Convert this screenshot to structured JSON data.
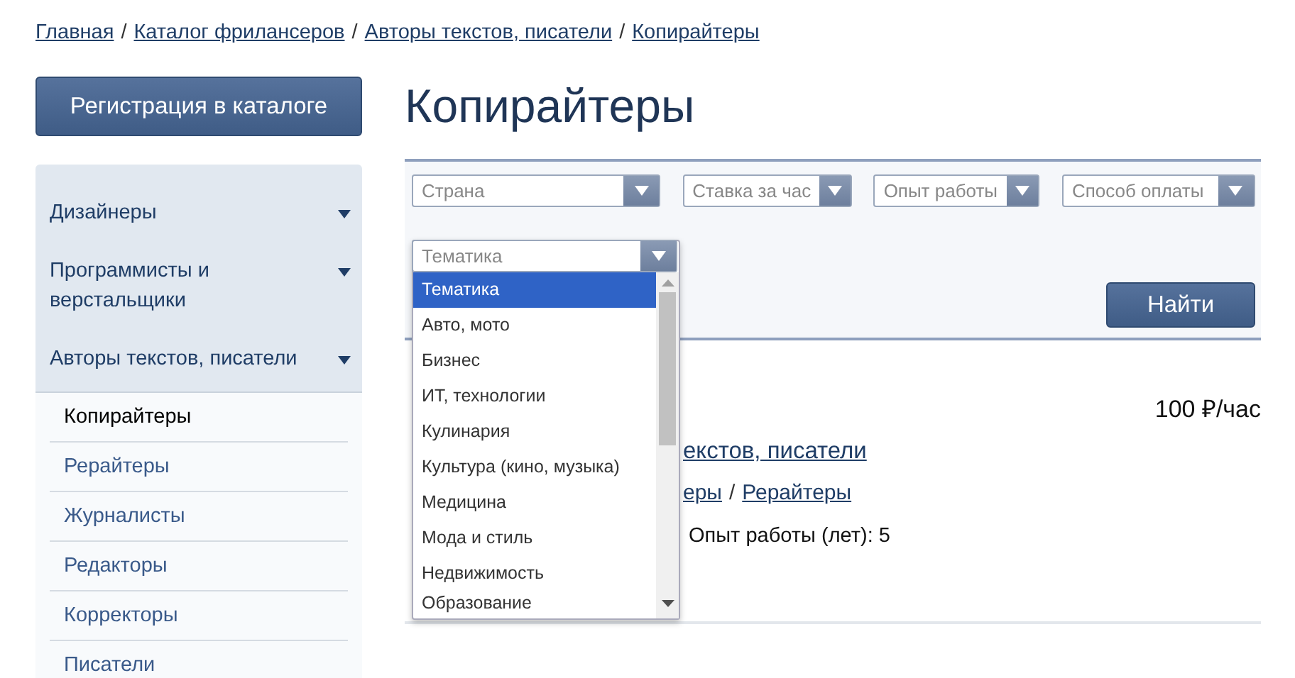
{
  "breadcrumbs": {
    "separator": "/",
    "items": [
      {
        "label": "Главная"
      },
      {
        "label": "Каталог фрилансеров"
      },
      {
        "label": "Авторы текстов, писатели"
      },
      {
        "label": "Копирайтеры"
      }
    ]
  },
  "register_button": "Регистрация в каталоге",
  "sidebar": {
    "categories": [
      {
        "label": "Дизайнеры"
      },
      {
        "label": "Программисты и верстальщики"
      },
      {
        "label": "Авторы текстов, писатели",
        "children": [
          {
            "label": "Копирайтеры",
            "selected": true
          },
          {
            "label": "Рерайтеры",
            "selected": false
          },
          {
            "label": "Журналисты",
            "selected": false
          },
          {
            "label": "Редакторы",
            "selected": false
          },
          {
            "label": "Корректоры",
            "selected": false
          },
          {
            "label": "Писатели",
            "selected": false
          }
        ]
      }
    ]
  },
  "page_title": "Копирайтеры",
  "filters": [
    {
      "placeholder": "Страна"
    },
    {
      "placeholder": "Ставка за час"
    },
    {
      "placeholder": "Опыт работы"
    },
    {
      "placeholder": "Способ оплаты"
    }
  ],
  "topic_select": {
    "value": "Тематика",
    "options": [
      {
        "label": "Тематика",
        "selected": true
      },
      {
        "label": "Авто, мото",
        "selected": false
      },
      {
        "label": "Бизнес",
        "selected": false
      },
      {
        "label": "ИТ, технологии",
        "selected": false
      },
      {
        "label": "Кулинария",
        "selected": false
      },
      {
        "label": "Культура (кино, музыка)",
        "selected": false
      },
      {
        "label": "Медицина",
        "selected": false
      },
      {
        "label": "Мода и стиль",
        "selected": false
      },
      {
        "label": "Недвижимость",
        "selected": false
      },
      {
        "label": "Образование",
        "selected": false
      }
    ]
  },
  "search_button": "Найти",
  "result": {
    "rate": "100 ₽/час",
    "category_link": "екстов, писатели",
    "separator": "/",
    "subcategory_links": [
      "еры",
      "Рерайтеры"
    ],
    "experience": "Опыт работы (лет): 5"
  }
}
